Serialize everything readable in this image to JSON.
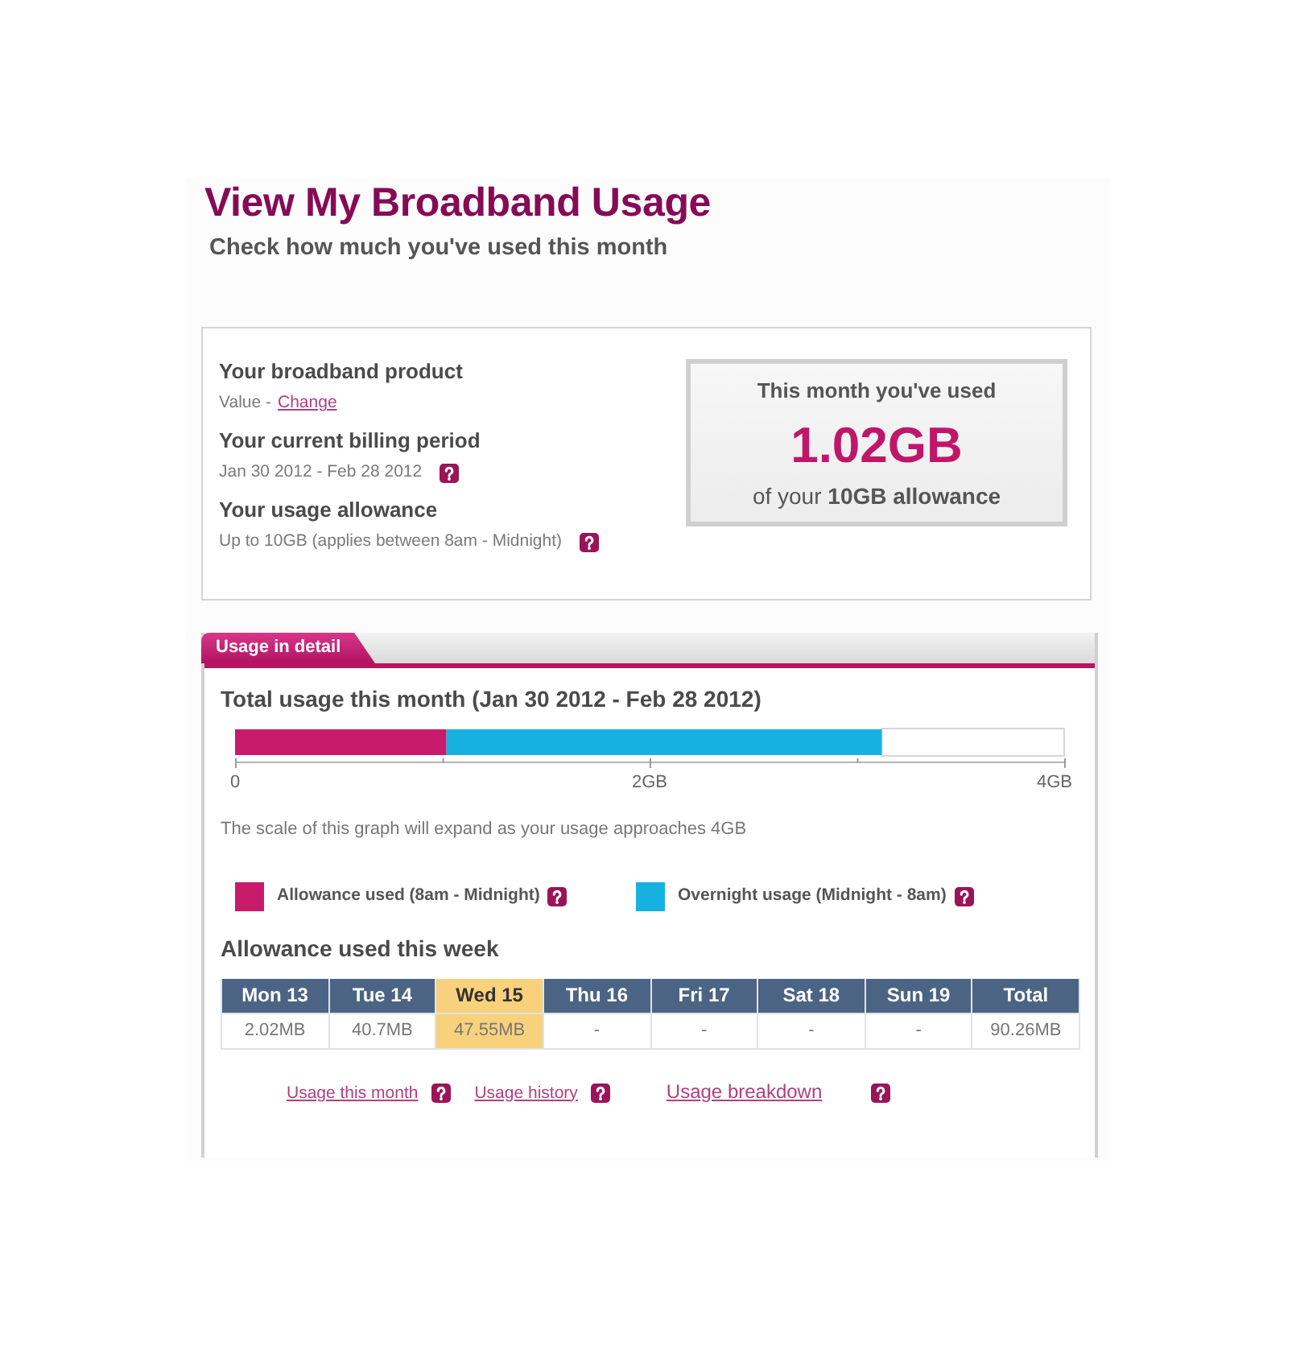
{
  "header": {
    "title": "View My Broadband Usage",
    "subtitle": "Check how much you've used this month"
  },
  "summary": {
    "items": [
      {
        "label": "Your broadband product",
        "value": "Value -",
        "link": "Change",
        "help": false
      },
      {
        "label": "Your current billing period",
        "value": "Jan 30 2012 - Feb 28 2012",
        "help": true
      },
      {
        "label": "Your usage allowance",
        "value": "Up to 10GB (applies between 8am - Midnight)",
        "help": true
      }
    ],
    "usage_box": {
      "caption": "This month you've used",
      "amount": "1.02GB",
      "note": "of your **10GB allowance**"
    }
  },
  "detail": {
    "tab": "Usage in detail",
    "chart_data": {
      "type": "bar",
      "orientation": "horizontal",
      "stacked": true,
      "title": "Total usage this month (Jan 30 2012 - Feb 28 2012)",
      "series": [
        {
          "name": "Allowance used (8am - Midnight)",
          "color": "#c81b6b",
          "values": [
            1.02
          ]
        },
        {
          "name": "Overnight usage (Midnight - 8am)",
          "color": "#17b1e1",
          "values": [
            2.1
          ]
        }
      ],
      "xlim": [
        0,
        4
      ],
      "xticks": [
        {
          "value": 0,
          "label": "0"
        },
        {
          "value": 2,
          "label": "2GB"
        },
        {
          "value": 4,
          "label": "4GB"
        }
      ],
      "legend": "bottom"
    },
    "scale_note": "The scale of this graph will expand as your usage approaches 4GB",
    "legend_help": true,
    "week": {
      "title": "Allowance used this week",
      "columns": [
        {
          "label": "Mon 13",
          "highlighted": false
        },
        {
          "label": "Tue 14",
          "highlighted": false
        },
        {
          "label": "Wed 15",
          "highlighted": true
        },
        {
          "label": "Thu 16",
          "highlighted": false
        },
        {
          "label": "Fri 17",
          "highlighted": false
        },
        {
          "label": "Sat 18",
          "highlighted": false
        },
        {
          "label": "Sun 19",
          "highlighted": false
        },
        {
          "label": "Total",
          "highlighted": false
        }
      ],
      "rows": [
        {
          "cells": [
            "2.02MB",
            "40.7MB",
            "47.55MB",
            "-",
            "-",
            "-",
            "-",
            "90.26MB"
          ]
        }
      ]
    },
    "links": [
      {
        "label": "Usage this month",
        "help": true,
        "kind": "plain"
      },
      {
        "label": "Usage history",
        "help": true,
        "kind": "plain"
      },
      {
        "label": "Usage breakdown",
        "help": true,
        "kind": "large"
      }
    ]
  }
}
